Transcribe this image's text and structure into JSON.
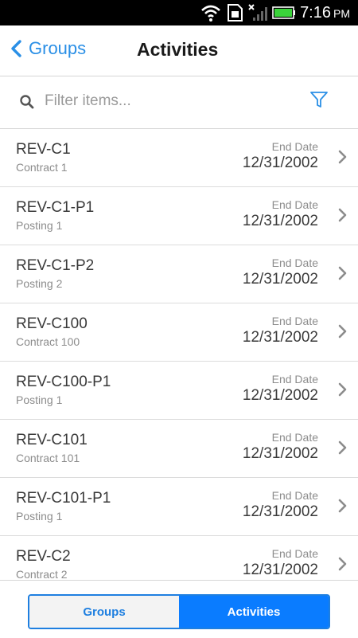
{
  "status_bar": {
    "time": "7:16",
    "ampm": "PM"
  },
  "header": {
    "back_label": "Groups",
    "title": "Activities"
  },
  "filter": {
    "placeholder": "Filter items..."
  },
  "items": [
    {
      "name": "REV-C1",
      "sub": "Contract 1",
      "date_label": "End Date",
      "date": "12/31/2002"
    },
    {
      "name": "REV-C1-P1",
      "sub": "Posting 1",
      "date_label": "End Date",
      "date": "12/31/2002"
    },
    {
      "name": "REV-C1-P2",
      "sub": "Posting 2",
      "date_label": "End Date",
      "date": "12/31/2002"
    },
    {
      "name": "REV-C100",
      "sub": "Contract 100",
      "date_label": "End Date",
      "date": "12/31/2002"
    },
    {
      "name": "REV-C100-P1",
      "sub": "Posting 1",
      "date_label": "End Date",
      "date": "12/31/2002"
    },
    {
      "name": "REV-C101",
      "sub": "Contract 101",
      "date_label": "End Date",
      "date": "12/31/2002"
    },
    {
      "name": "REV-C101-P1",
      "sub": "Posting 1",
      "date_label": "End Date",
      "date": "12/31/2002"
    },
    {
      "name": "REV-C2",
      "sub": "Contract 2",
      "date_label": "End Date",
      "date": "12/31/2002"
    }
  ],
  "bottom_tabs": {
    "groups_label": "Groups",
    "activities_label": "Activities",
    "selected": "Activities"
  },
  "colors": {
    "accent": "#0a7cff",
    "link": "#2a8fe6"
  },
  "icons": [
    "wifi-icon",
    "sim-icon",
    "signal-icon",
    "battery-icon",
    "chevron-left-icon",
    "search-icon",
    "filter-icon",
    "chevron-right-icon"
  ]
}
